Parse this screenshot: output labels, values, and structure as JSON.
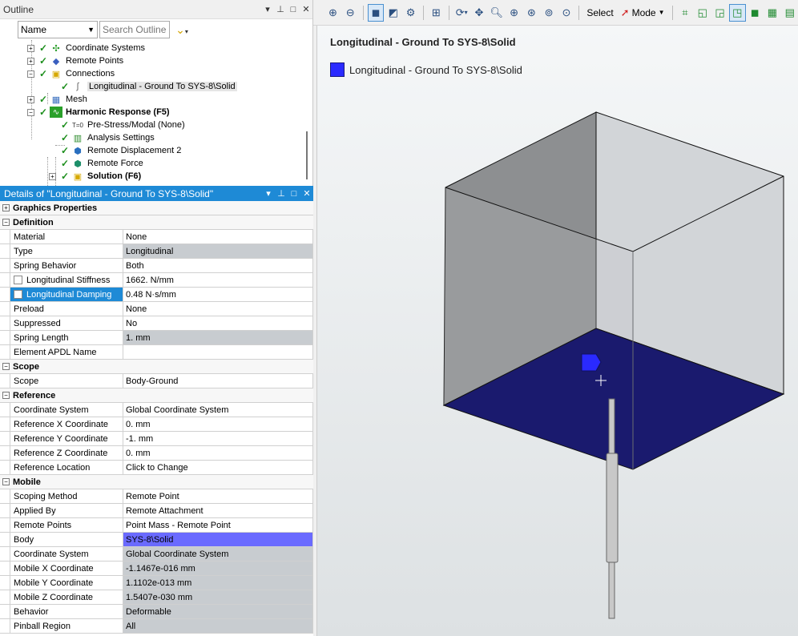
{
  "outline": {
    "title": "Outline",
    "controls": [
      "▾",
      "⊥",
      "□",
      "✕"
    ],
    "filter": {
      "value": "Name",
      "search_placeholder": "Search Outline"
    },
    "tree": [
      {
        "label": "Coordinate Systems"
      },
      {
        "label": "Remote Points"
      },
      {
        "label": "Connections"
      },
      {
        "label": "Longitudinal - Ground To SYS-8\\Solid"
      },
      {
        "label": "Mesh"
      },
      {
        "label": "Harmonic Response (F5)"
      },
      {
        "label": "Pre-Stress/Modal (None)"
      },
      {
        "label": "Analysis Settings"
      },
      {
        "label": "Remote Displacement 2"
      },
      {
        "label": "Remote Force"
      },
      {
        "label": "Solution (F6)"
      }
    ]
  },
  "details": {
    "title": "Details of \"Longitudinal - Ground To SYS-8\\Solid\"",
    "sections": {
      "graphics": "Graphics Properties",
      "definition": "Definition",
      "scope": "Scope",
      "reference": "Reference",
      "mobile": "Mobile"
    },
    "definition": [
      {
        "key": "Material",
        "value": "None"
      },
      {
        "key": "Type",
        "value": "Longitudinal"
      },
      {
        "key": "Spring Behavior",
        "value": "Both"
      },
      {
        "key": "Longitudinal Stiffness",
        "value": "1662. N/mm"
      },
      {
        "key": "Longitudinal Damping",
        "value": "0.48 N·s/mm"
      },
      {
        "key": "Preload",
        "value": "None"
      },
      {
        "key": "Suppressed",
        "value": "No"
      },
      {
        "key": "Spring Length",
        "value": "1. mm"
      },
      {
        "key": "Element APDL Name",
        "value": ""
      }
    ],
    "scope": [
      {
        "key": "Scope",
        "value": "Body-Ground"
      }
    ],
    "reference": [
      {
        "key": "Coordinate System",
        "value": "Global Coordinate System"
      },
      {
        "key": "Reference X Coordinate",
        "value": "0. mm"
      },
      {
        "key": "Reference Y Coordinate",
        "value": "-1. mm"
      },
      {
        "key": "Reference Z Coordinate",
        "value": "0. mm"
      },
      {
        "key": "Reference Location",
        "value": "Click to Change"
      }
    ],
    "mobile": [
      {
        "key": "Scoping Method",
        "value": "Remote Point"
      },
      {
        "key": "Applied By",
        "value": "Remote Attachment"
      },
      {
        "key": "Remote Points",
        "value": "Point Mass - Remote Point"
      },
      {
        "key": "Body",
        "value": "SYS-8\\Solid"
      },
      {
        "key": "Coordinate System",
        "value": "Global Coordinate System"
      },
      {
        "key": "Mobile X Coordinate",
        "value": "-1.1467e-016 mm"
      },
      {
        "key": "Mobile Y Coordinate",
        "value": "1.1102e-013 mm"
      },
      {
        "key": "Mobile Z Coordinate",
        "value": "1.5407e-030 mm"
      },
      {
        "key": "Behavior",
        "value": "Deformable"
      },
      {
        "key": "Pinball Region",
        "value": "All"
      }
    ]
  },
  "toolbar": {
    "select_label": "Select",
    "mode_label": "Mode"
  },
  "viewport": {
    "title": "Longitudinal - Ground To SYS-8\\Solid",
    "legend_label": "Longitudinal - Ground To SYS-8\\Solid",
    "legend_color": "#2a2aff"
  },
  "colors": {
    "accent": "#1e8ad6",
    "selected_body": "#6a6aff",
    "readonly_cell": "#c8ccd0",
    "cube_bottom": "#1a1a6e"
  }
}
